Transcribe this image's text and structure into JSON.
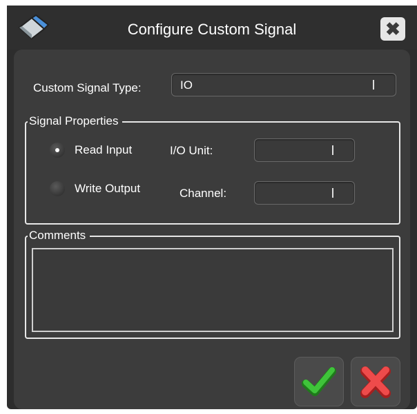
{
  "dialog": {
    "title": "Configure Custom Signal",
    "close_icon": "close-icon"
  },
  "custom_signal_type": {
    "label": "Custom Signal Type:",
    "value": "IO"
  },
  "signal_properties": {
    "legend": "Signal Properties",
    "read_input_label": "Read Input",
    "read_input_selected": true,
    "write_output_label": "Write Output",
    "write_output_selected": false,
    "io_unit_label": "I/O Unit:",
    "io_unit_value": "",
    "channel_label": "Channel:",
    "channel_value": ""
  },
  "comments": {
    "legend": "Comments",
    "value": ""
  },
  "actions": {
    "ok_icon": "checkmark-icon",
    "cancel_icon": "x-mark-icon"
  },
  "colors": {
    "ok_green": "#33b22e",
    "cancel_red": "#e23a3a",
    "background": "#3c3c3c"
  }
}
